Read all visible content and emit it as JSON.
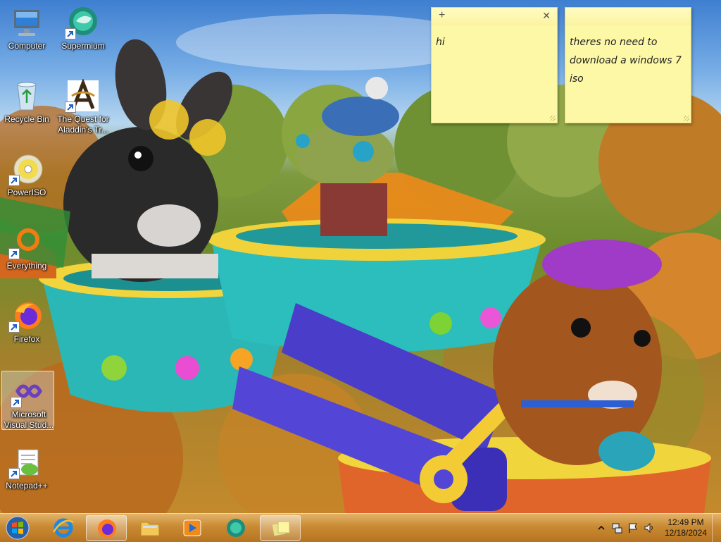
{
  "desktop": {
    "icons": [
      {
        "label": "Computer"
      },
      {
        "label": "Supermium"
      },
      {
        "label": "Recycle Bin"
      },
      {
        "label": "The Quest for Aladdin's Tr..."
      },
      {
        "label": "PowerISO"
      },
      {
        "label": "Everything"
      },
      {
        "label": "Firefox"
      },
      {
        "label": "Microsoft Visual Stud..."
      },
      {
        "label": "Notepad++"
      }
    ]
  },
  "sticky_notes": [
    {
      "text": "hi",
      "add_icon": "plus-icon",
      "close_icon": "close-icon"
    },
    {
      "text": "theres no need to download a windows 7 iso"
    }
  ],
  "taskbar": {
    "start_icon": "windows-logo-icon",
    "pinned": [
      "internet-explorer-icon",
      "firefox-icon",
      "file-explorer-icon",
      "media-player-icon",
      "supermium-icon",
      "sticky-notes-icon"
    ],
    "tray_icons": [
      "show-hidden-icons",
      "network-icon",
      "action-center-flag-icon",
      "volume-icon"
    ],
    "clock": {
      "time": "12:49 PM",
      "date": "12/18/2024"
    }
  },
  "colors": {
    "taskbar": "#c98a33",
    "note": "#fdf8a6"
  }
}
